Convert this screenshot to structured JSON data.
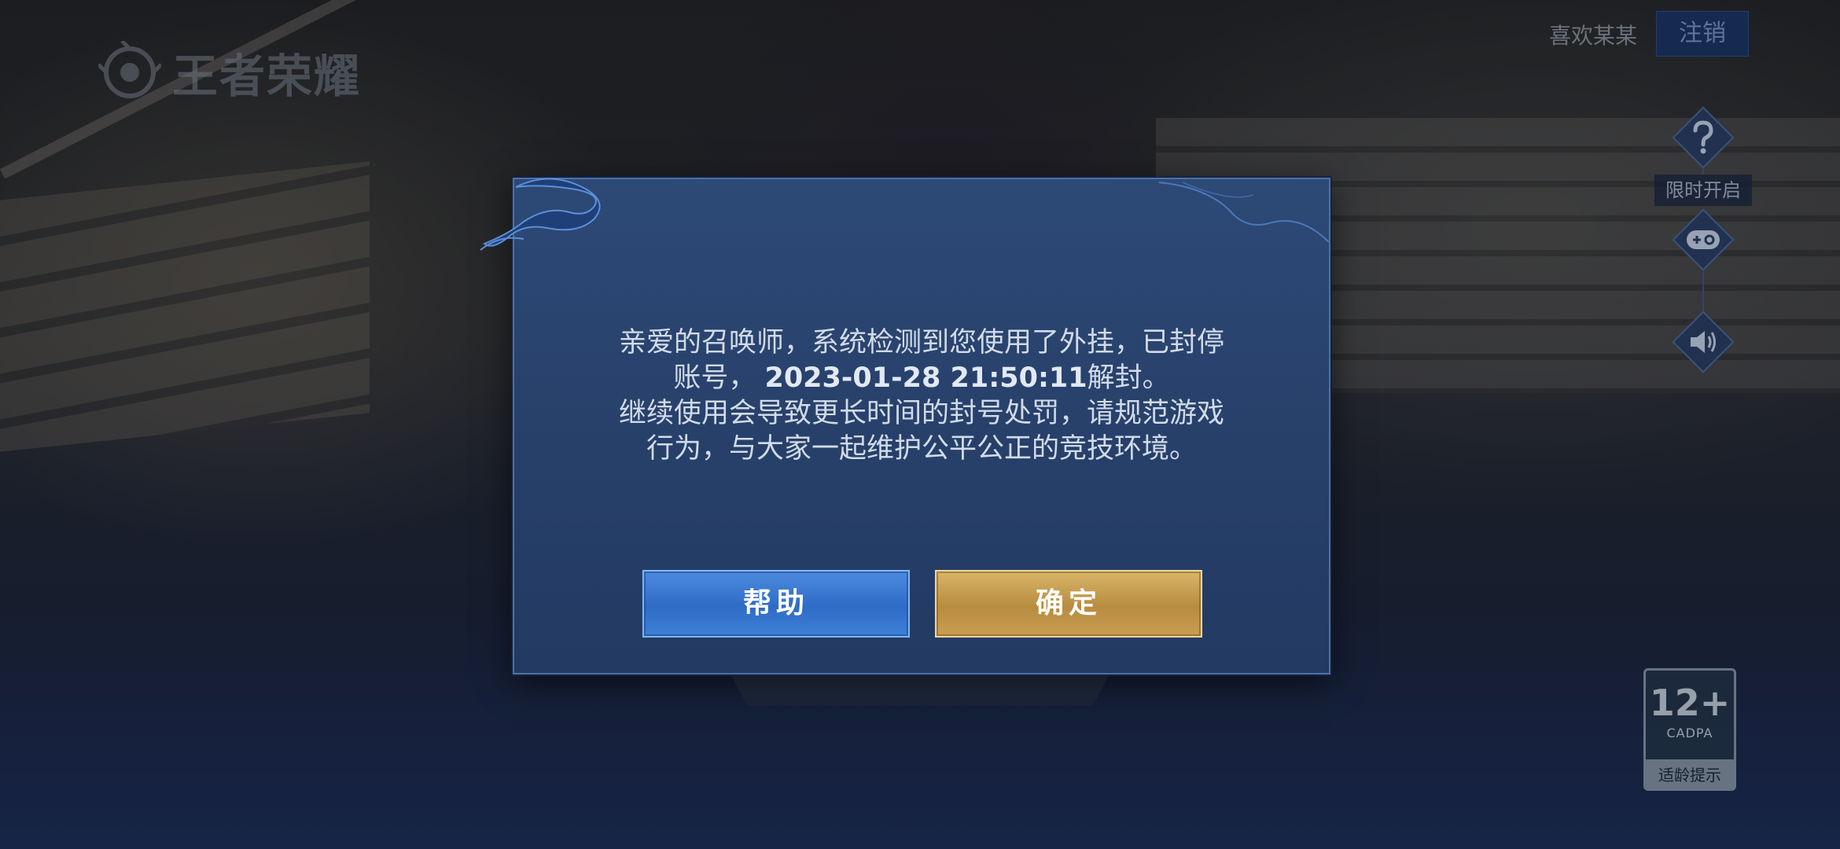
{
  "logo": {
    "text": "王者荣耀"
  },
  "topbar": {
    "account_name": "喜欢某某",
    "logout_label": "注销"
  },
  "sidebar": {
    "help_icon": "question-icon",
    "limited_label": "限时开启",
    "gamepad_icon": "gamepad-icon",
    "volume_icon": "speaker-icon"
  },
  "age_rating": {
    "age": "12+",
    "org": "CADPA",
    "tip": "适龄提示"
  },
  "dialog": {
    "line1": "亲爱的召唤师，系统检测到您使用了外挂，已封停",
    "line2_prefix": "账号，",
    "line2_date": "2023-01-28 21:50:11",
    "line2_suffix": "解封。",
    "line3": "继续使用会导致更长时间的封号处罚，请规范游戏",
    "line4": "行为，与大家一起维护公平公正的竞技环境。",
    "help_label": "帮助",
    "confirm_label": "确定"
  },
  "colors": {
    "dialog_bg": "#27406a",
    "help_button": "#2f6bc6",
    "confirm_button": "#b78c3e"
  }
}
